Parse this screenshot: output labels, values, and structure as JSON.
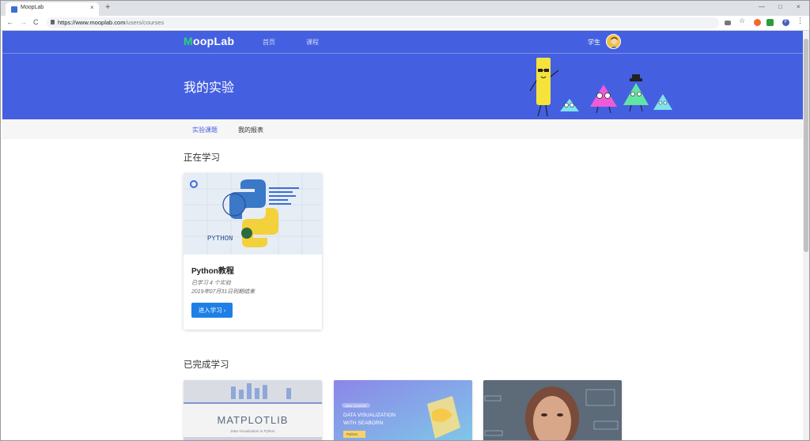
{
  "browser": {
    "tab_title": "MoopLab",
    "tab_close": "×",
    "new_tab": "+",
    "url_host": "https://www.mooplab.com",
    "url_path": "/users/courses",
    "back_icon": "←",
    "forward_icon": "→",
    "reload_icon": "C",
    "window_controls": [
      "—",
      "□",
      "×"
    ],
    "profile_initial": "F"
  },
  "header": {
    "logo_initial": "M",
    "logo_rest": "oopLab",
    "nav": [
      "首页",
      "课程"
    ],
    "user_label": "学生"
  },
  "hero": {
    "title": "我的实验"
  },
  "subnav": {
    "items": [
      "实验课题",
      "我的报表"
    ],
    "active_index": 0
  },
  "learning": {
    "section_title": "正在学习",
    "course": {
      "image_text": "PYTHON",
      "title": "Python教程",
      "progress_text": "已学习 4 个实验",
      "expiry_text": "2019年07月31日到期结束",
      "button_label": "进入学习 ›"
    }
  },
  "completed": {
    "section_title": "已完成学习",
    "cards": [
      {
        "title": "MATPLOTLIB",
        "subtitle": "Data Visualization in Python"
      },
      {
        "badge": "NEW COURSE",
        "title_line1": "DATA VISUALIZATION",
        "title_line2": "WITH SEABORN",
        "tag": "Python"
      },
      {
        "title": ""
      }
    ]
  },
  "colors": {
    "primary": "#4460e0",
    "accent_green": "#2dd17a",
    "button": "#1e7fe6"
  }
}
